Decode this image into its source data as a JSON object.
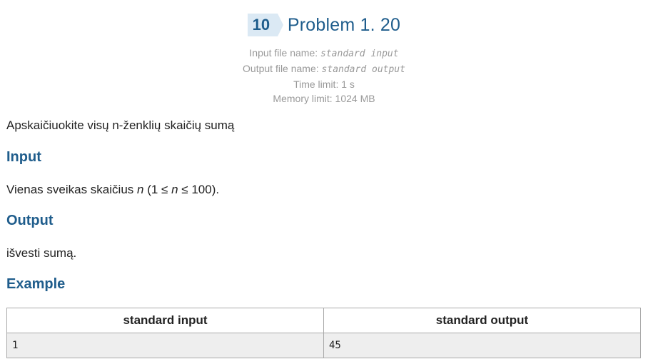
{
  "problem": {
    "number": "10",
    "title": "Problem 1. 20"
  },
  "limits": {
    "input_label": "Input file name: ",
    "input_value": "standard input",
    "output_label": "Output file name: ",
    "output_value": "standard output",
    "time": "Time limit: 1 s",
    "memory": "Memory limit: 1024 MB"
  },
  "statement": "Apskaičiuokite visų n-ženklių skaičių sumą",
  "input_section": {
    "heading": "Input",
    "text_before": "Vienas sveikas skaičius ",
    "var1": "n",
    "text_mid1": " (1 ≤ ",
    "var2": "n",
    "text_after": " ≤ 100)."
  },
  "output_section": {
    "heading": "Output",
    "text": "išvesti sumą."
  },
  "example": {
    "heading": "Example",
    "columns": [
      "standard input",
      "standard output"
    ],
    "rows": [
      [
        "1",
        "45"
      ]
    ]
  }
}
